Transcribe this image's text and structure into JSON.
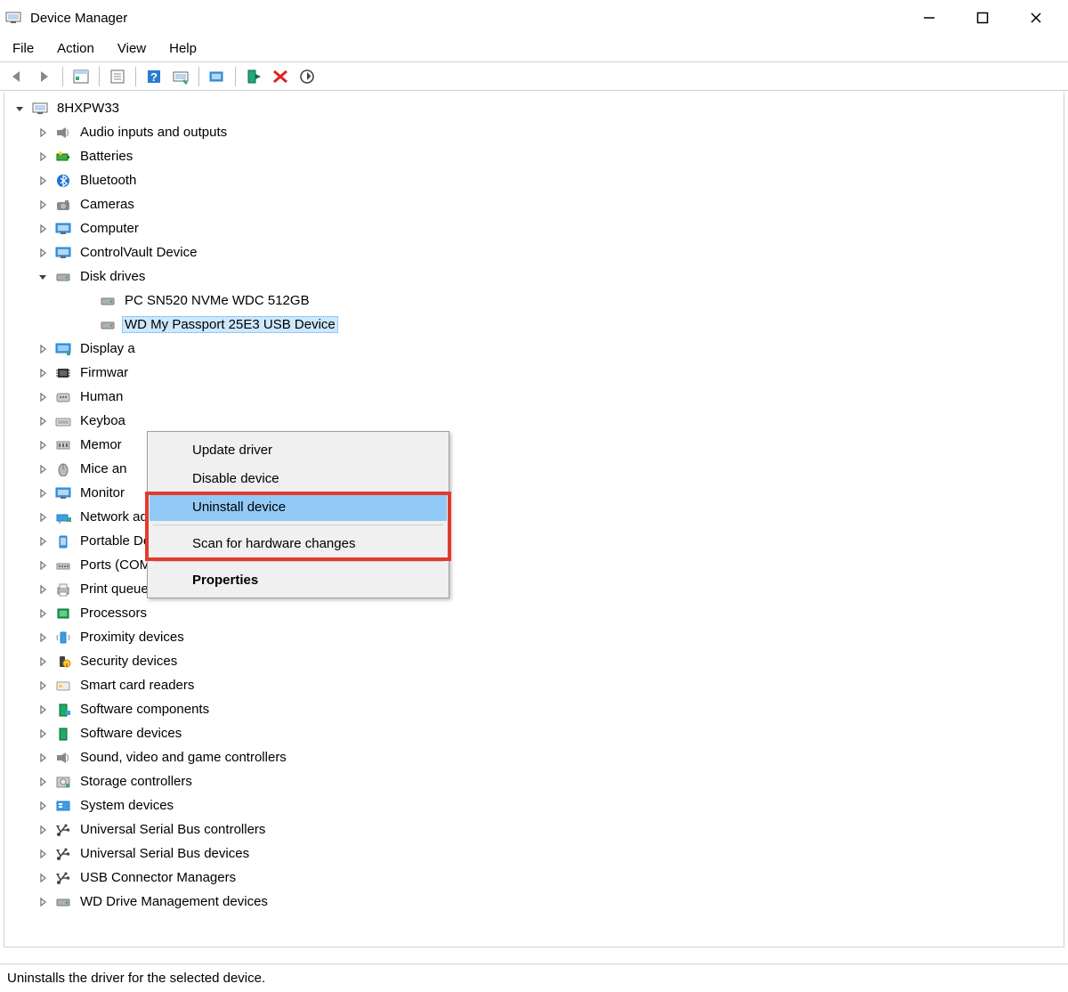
{
  "window": {
    "title": "Device Manager"
  },
  "menubar": {
    "items": [
      "File",
      "Action",
      "View",
      "Help"
    ]
  },
  "tree": {
    "root": "8HXPW33",
    "categories": [
      {
        "label": "Audio inputs and outputs",
        "icon": "speaker"
      },
      {
        "label": "Batteries",
        "icon": "battery"
      },
      {
        "label": "Bluetooth",
        "icon": "bluetooth"
      },
      {
        "label": "Cameras",
        "icon": "camera"
      },
      {
        "label": "Computer",
        "icon": "monitor"
      },
      {
        "label": "ControlVault Device",
        "icon": "monitor"
      },
      {
        "label": "Disk drives",
        "icon": "disk",
        "expanded": true,
        "children": [
          {
            "label": "PC SN520 NVMe WDC 512GB",
            "icon": "disk"
          },
          {
            "label": "WD My Passport 25E3 USB Device",
            "icon": "disk",
            "selected": true
          }
        ]
      },
      {
        "label": "Display adapters",
        "icon": "display",
        "clipped": "Display a"
      },
      {
        "label": "Firmware",
        "icon": "chip",
        "clipped": "Firmwar"
      },
      {
        "label": "Human Interface Devices",
        "icon": "hid",
        "clipped": "Human"
      },
      {
        "label": "Keyboards",
        "icon": "keyboard",
        "clipped": "Keyboa"
      },
      {
        "label": "Memory technology devices",
        "icon": "memory",
        "clipped": "Memor"
      },
      {
        "label": "Mice and other pointing devices",
        "icon": "mouse",
        "clipped": "Mice an"
      },
      {
        "label": "Monitors",
        "icon": "monitor",
        "clipped": "Monitor"
      },
      {
        "label": "Network adapters",
        "icon": "network"
      },
      {
        "label": "Portable Devices",
        "icon": "portable"
      },
      {
        "label": "Ports (COM & LPT)",
        "icon": "port"
      },
      {
        "label": "Print queues",
        "icon": "printer"
      },
      {
        "label": "Processors",
        "icon": "cpu"
      },
      {
        "label": "Proximity devices",
        "icon": "proximity"
      },
      {
        "label": "Security devices",
        "icon": "security"
      },
      {
        "label": "Smart card readers",
        "icon": "smartcard"
      },
      {
        "label": "Software components",
        "icon": "software"
      },
      {
        "label": "Software devices",
        "icon": "software2"
      },
      {
        "label": "Sound, video and game controllers",
        "icon": "speaker"
      },
      {
        "label": "Storage controllers",
        "icon": "storage"
      },
      {
        "label": "System devices",
        "icon": "system"
      },
      {
        "label": "Universal Serial Bus controllers",
        "icon": "usb"
      },
      {
        "label": "Universal Serial Bus devices",
        "icon": "usb"
      },
      {
        "label": "USB Connector Managers",
        "icon": "usb"
      },
      {
        "label": "WD Drive Management devices",
        "icon": "disk"
      }
    ]
  },
  "context_menu": {
    "items": [
      {
        "label": "Update driver"
      },
      {
        "label": "Disable device"
      },
      {
        "label": "Uninstall device",
        "highlighted": true
      },
      {
        "sep": true
      },
      {
        "label": "Scan for hardware changes"
      },
      {
        "sep": true
      },
      {
        "label": "Properties",
        "bold": true
      }
    ]
  },
  "statusbar": {
    "text": "Uninstalls the driver for the selected device."
  }
}
